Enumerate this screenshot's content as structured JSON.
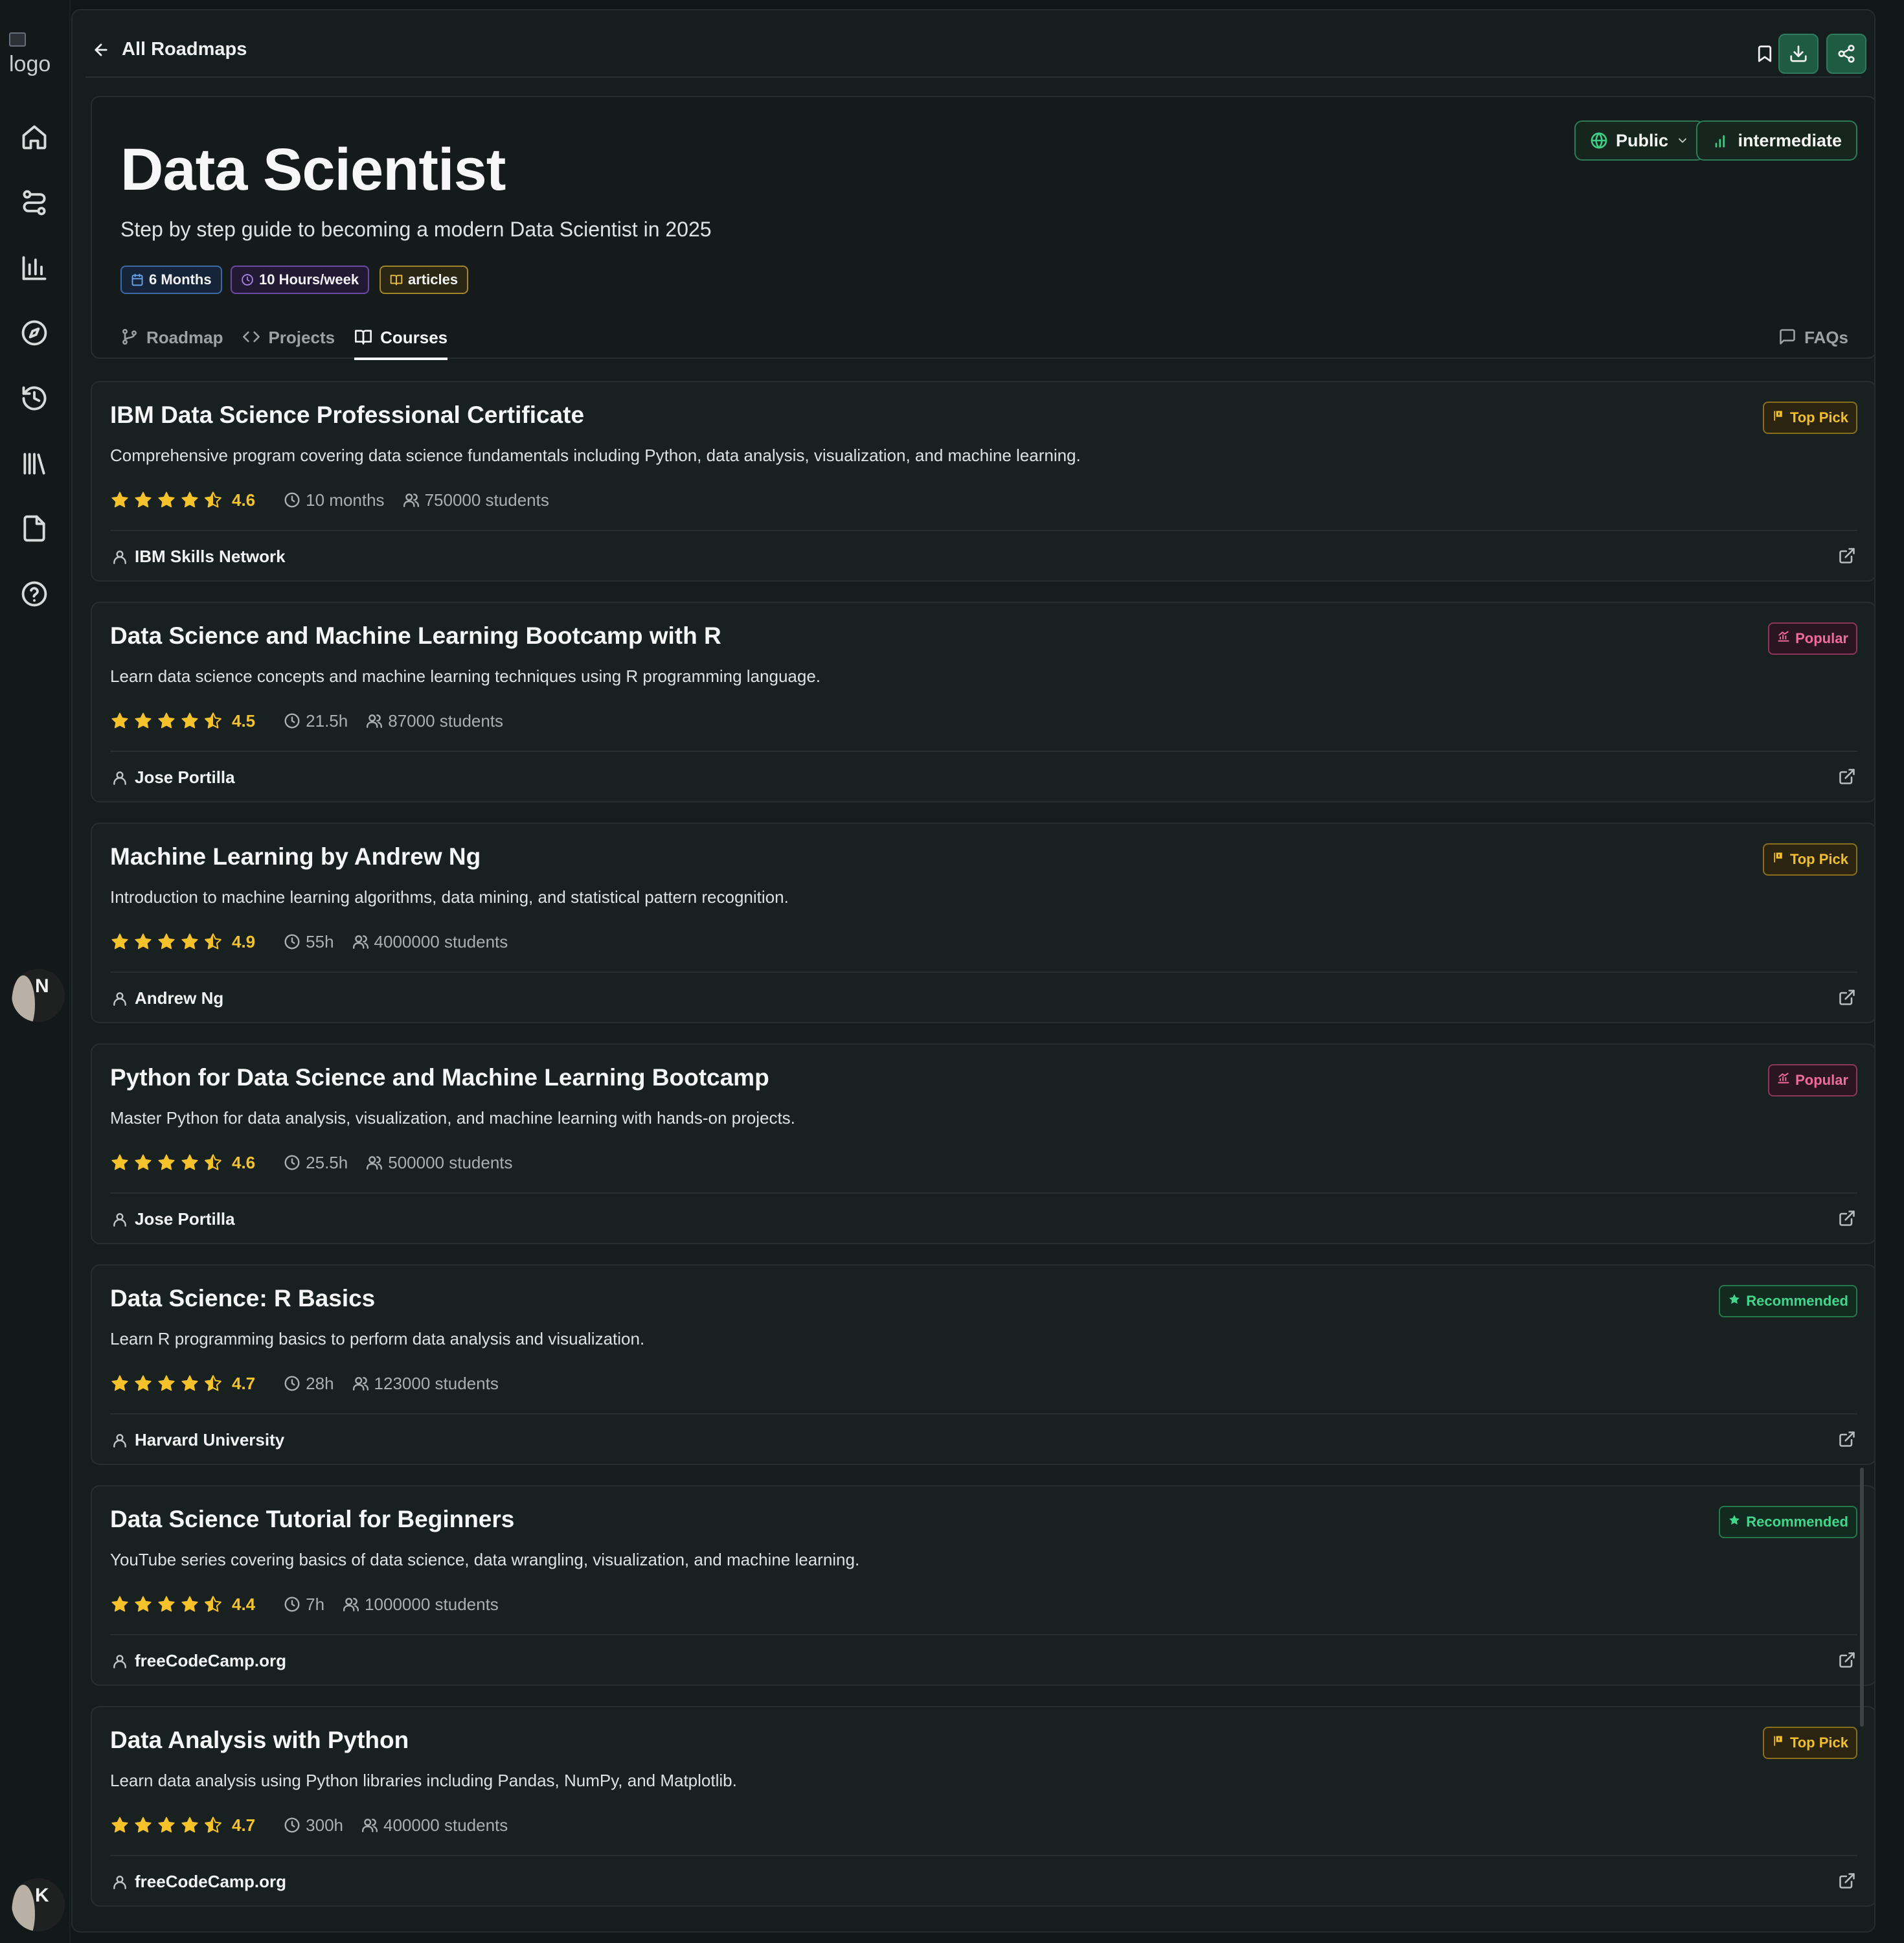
{
  "sidebar": {
    "logo_alt": "logo",
    "items": [
      {
        "icon": "home-icon"
      },
      {
        "icon": "roadmaps-icon"
      },
      {
        "icon": "chart-icon"
      },
      {
        "icon": "compass-icon"
      },
      {
        "icon": "history-icon"
      },
      {
        "icon": "library-icon"
      },
      {
        "icon": "file-icon"
      },
      {
        "icon": "help-icon"
      }
    ],
    "avatar_top_initial": "N",
    "avatar_bottom_initial": "K"
  },
  "topbar": {
    "back_label": "All Roadmaps",
    "actions": [
      "bookmark-icon",
      "download-icon",
      "share-icon"
    ]
  },
  "roadmap": {
    "title": "Data Scientist",
    "subtitle": "Step by step guide to becoming a modern Data Scientist in 2025",
    "visibility": "Public",
    "level": "intermediate",
    "tags": {
      "duration": "6 Months",
      "hours": "10 Hours/week",
      "resources": "articles"
    },
    "tabs": {
      "roadmap": "Roadmap",
      "projects": "Projects",
      "courses": "Courses",
      "faqs": "FAQs"
    },
    "active_tab": "Courses"
  },
  "courses": [
    {
      "title": "IBM Data Science Professional Certificate",
      "description": "Comprehensive program covering data science fundamentals including Python, data analysis, visualization, and machine learning.",
      "rating": "4.6",
      "stars_filled": 4,
      "duration": "10 months",
      "students": "750000 students",
      "provider": "IBM Skills Network",
      "badge": "Top Pick",
      "badge_type": "toppick"
    },
    {
      "title": "Data Science and Machine Learning Bootcamp with R",
      "description": "Learn data science concepts and machine learning techniques using R programming language.",
      "rating": "4.5",
      "stars_filled": 4,
      "duration": "21.5h",
      "students": "87000 students",
      "provider": "Jose Portilla",
      "badge": "Popular",
      "badge_type": "popular"
    },
    {
      "title": "Machine Learning by Andrew Ng",
      "description": "Introduction to machine learning algorithms, data mining, and statistical pattern recognition.",
      "rating": "4.9",
      "stars_filled": 4,
      "duration": "55h",
      "students": "4000000 students",
      "provider": "Andrew Ng",
      "badge": "Top Pick",
      "badge_type": "toppick"
    },
    {
      "title": "Python for Data Science and Machine Learning Bootcamp",
      "description": "Master Python for data analysis, visualization, and machine learning with hands-on projects.",
      "rating": "4.6",
      "stars_filled": 4,
      "duration": "25.5h",
      "students": "500000 students",
      "provider": "Jose Portilla",
      "badge": "Popular",
      "badge_type": "popular"
    },
    {
      "title": "Data Science: R Basics",
      "description": "Learn R programming basics to perform data analysis and visualization.",
      "rating": "4.7",
      "stars_filled": 4,
      "duration": "28h",
      "students": "123000 students",
      "provider": "Harvard University",
      "badge": "Recommended",
      "badge_type": "recommended"
    },
    {
      "title": "Data Science Tutorial for Beginners",
      "description": "YouTube series covering basics of data science, data wrangling, visualization, and machine learning.",
      "rating": "4.4",
      "stars_filled": 4,
      "duration": "7h",
      "students": "1000000 students",
      "provider": "freeCodeCamp.org",
      "badge": "Recommended",
      "badge_type": "recommended"
    },
    {
      "title": "Data Analysis with Python",
      "description": "Learn data analysis using Python libraries including Pandas, NumPy, and Matplotlib.",
      "rating": "4.7",
      "stars_filled": 4,
      "duration": "300h",
      "students": "400000 students",
      "provider": "freeCodeCamp.org",
      "badge": "Top Pick",
      "badge_type": "toppick"
    }
  ],
  "colors": {
    "accent_green": "#3ecf87",
    "star": "#f5c22b",
    "top_pick": "#f2be2a",
    "popular": "#f06a9c",
    "recommended": "#41d68a"
  }
}
